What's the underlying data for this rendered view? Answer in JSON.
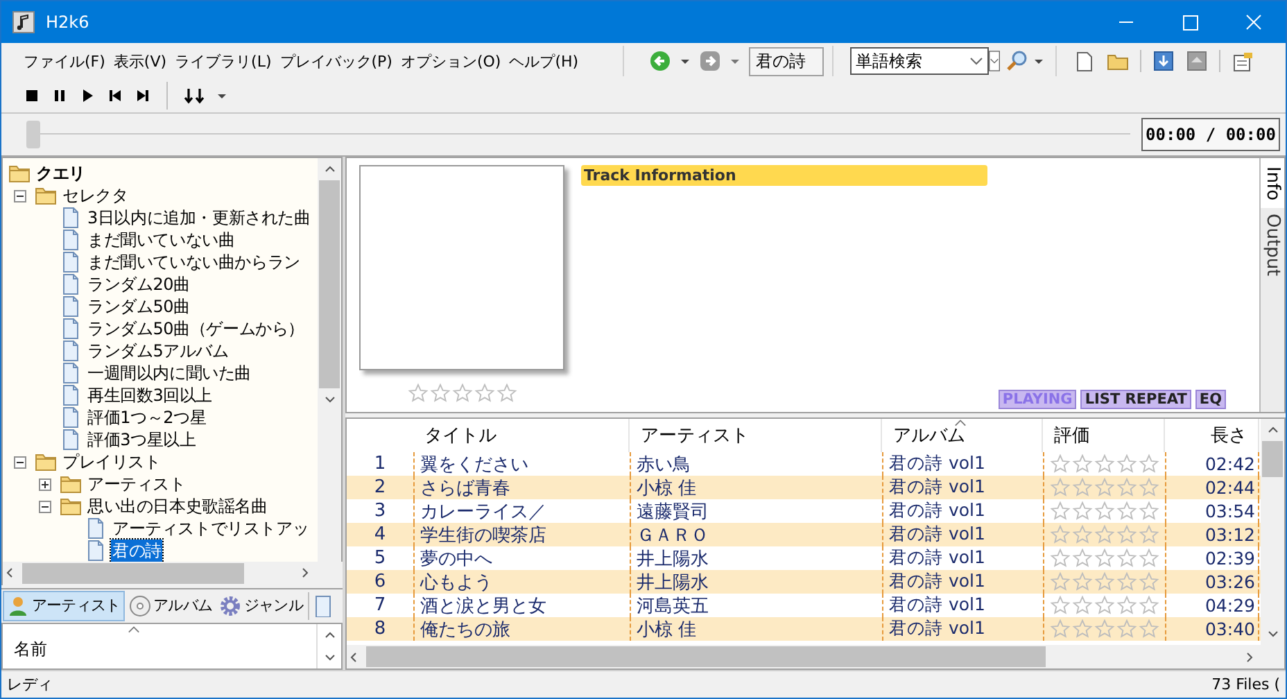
{
  "window": {
    "title": "H2k6"
  },
  "menu": [
    "ファイル(F)",
    "表示(V)",
    "ライブラリ(L)",
    "プレイバック(P)",
    "オプション(O)",
    "ヘルプ(H)"
  ],
  "toolbar": {
    "history_field": "君の詩",
    "search_mode": "単語検索"
  },
  "seek": {
    "level": 0
  },
  "time": "00:00 / 00:00",
  "tree": [
    {
      "label": "クエリ",
      "kind": "folder",
      "selected": false,
      "children": [
        {
          "label": "セレクタ",
          "kind": "folder",
          "expanded": true,
          "selected": false,
          "children": [
            {
              "label": "3日以内に追加・更新された曲",
              "kind": "file",
              "selected": false
            },
            {
              "label": "まだ聞いていない曲",
              "kind": "file",
              "selected": false
            },
            {
              "label": "まだ聞いていない曲からラン",
              "kind": "file",
              "selected": false
            },
            {
              "label": "ランダム20曲",
              "kind": "file",
              "selected": false
            },
            {
              "label": "ランダム50曲",
              "kind": "file",
              "selected": false
            },
            {
              "label": "ランダム50曲（ゲームから）",
              "kind": "file",
              "selected": false
            },
            {
              "label": "ランダム5アルバム",
              "kind": "file",
              "selected": false
            },
            {
              "label": "一週間以内に聞いた曲",
              "kind": "file",
              "selected": false
            },
            {
              "label": "再生回数3回以上",
              "kind": "file",
              "selected": false
            },
            {
              "label": "評価1つ～2つ星",
              "kind": "file",
              "selected": false
            },
            {
              "label": "評価3つ星以上",
              "kind": "file",
              "selected": false
            }
          ]
        },
        {
          "label": "プレイリスト",
          "kind": "folder",
          "expanded": true,
          "selected": false,
          "children": [
            {
              "label": "アーティスト",
              "kind": "folder",
              "expanded": false,
              "selected": false
            },
            {
              "label": "思い出の日本史歌謡名曲",
              "kind": "folder",
              "expanded": true,
              "selected": false,
              "children": [
                {
                  "label": "アーティストでリストアッ",
                  "kind": "file",
                  "selected": false
                },
                {
                  "label": "君の詩",
                  "kind": "file",
                  "selected": true
                }
              ]
            }
          ]
        }
      ]
    }
  ],
  "browse_tabs": [
    {
      "label": "アーティスト",
      "kind": "person",
      "selected": true
    },
    {
      "label": "アルバム",
      "kind": "disc",
      "selected": false
    },
    {
      "label": "ジャンル",
      "kind": "gear",
      "selected": false
    }
  ],
  "browse_list": {
    "columns": [
      "名前"
    ]
  },
  "info": {
    "header": "Track Information",
    "stars": 0,
    "flags": [
      {
        "label": "PLAYING",
        "on": false
      },
      {
        "label": "LIST REPEAT",
        "on": true
      },
      {
        "label": "EQ",
        "on": true
      }
    ],
    "tabs": [
      {
        "label": "Info",
        "selected": true
      },
      {
        "label": "Output",
        "selected": false
      }
    ]
  },
  "table": {
    "columns": [
      "タイトル",
      "アーティスト",
      "アルバム",
      "評価",
      "長さ"
    ],
    "rows": [
      {
        "number": "1",
        "title": "翼をください",
        "artist": "赤い鳥",
        "album": "君の詩 vol1",
        "stars": 0,
        "length": "02:42"
      },
      {
        "number": "2",
        "title": "さらば青春",
        "artist": "小椋 佳",
        "album": "君の詩 vol1",
        "stars": 0,
        "length": "02:44"
      },
      {
        "number": "3",
        "title": "カレーライス／",
        "artist": "遠藤賢司",
        "album": "君の詩 vol1",
        "stars": 0,
        "length": "03:54"
      },
      {
        "number": "4",
        "title": "学生街の喫茶店",
        "artist": "ＧＡＲＯ",
        "album": "君の詩 vol1",
        "stars": 0,
        "length": "03:12"
      },
      {
        "number": "5",
        "title": "夢の中へ",
        "artist": "井上陽水",
        "album": "君の詩 vol1",
        "stars": 0,
        "length": "02:39"
      },
      {
        "number": "6",
        "title": "心もよう",
        "artist": "井上陽水",
        "album": "君の詩 vol1",
        "stars": 0,
        "length": "03:26"
      },
      {
        "number": "7",
        "title": "酒と涙と男と女",
        "artist": "河島英五",
        "album": "君の詩 vol1",
        "stars": 0,
        "length": "04:29"
      },
      {
        "number": "8",
        "title": "俺たちの旅",
        "artist": "小椋 佳",
        "album": "君の詩 vol1",
        "stars": 0,
        "length": "03:40"
      }
    ]
  },
  "status_bar": {
    "left": "レディ",
    "right": "73 Files ("
  }
}
